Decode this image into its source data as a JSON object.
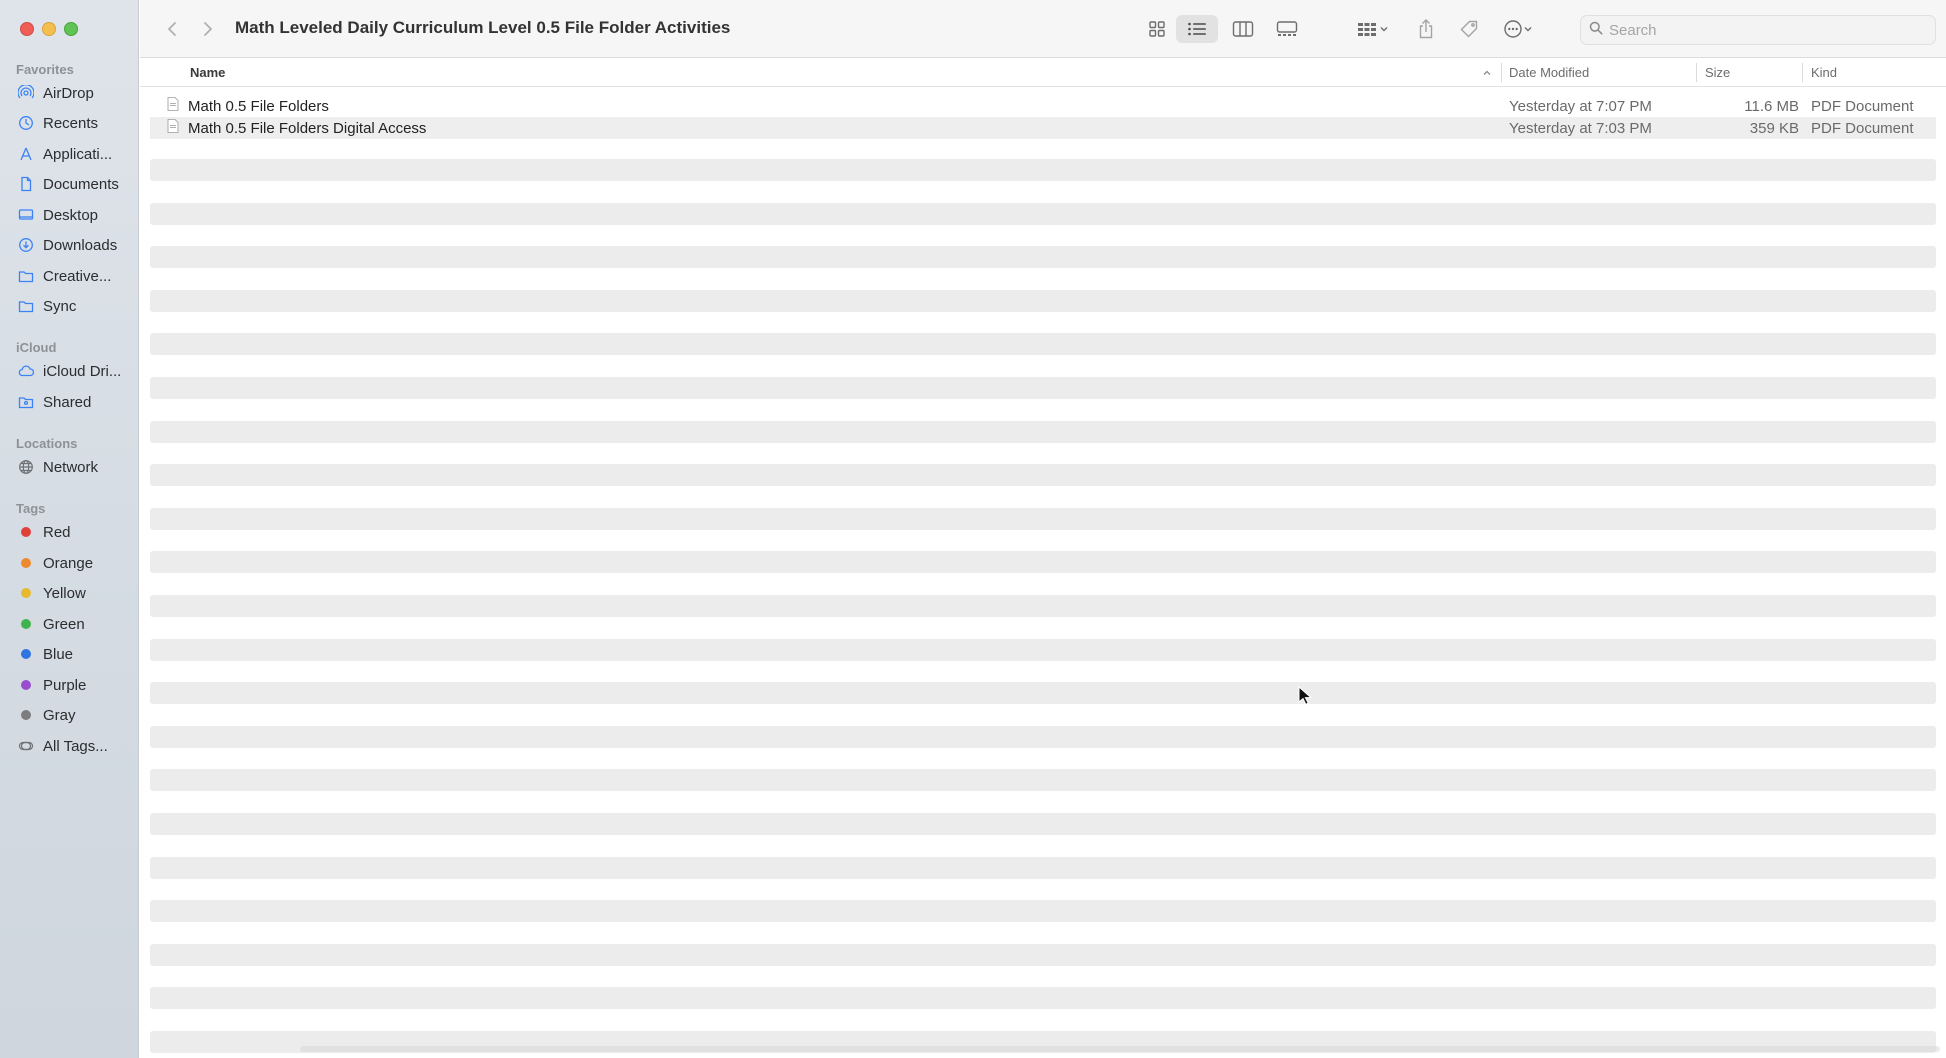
{
  "window": {
    "title": "Math Leveled Daily Curriculum Level 0.5 File Folder Activities"
  },
  "sidebar": {
    "favorites_header": "Favorites",
    "favorites": [
      {
        "label": "AirDrop",
        "icon": "airdrop-icon"
      },
      {
        "label": "Recents",
        "icon": "clock-icon"
      },
      {
        "label": "Applicati...",
        "icon": "applications-icon"
      },
      {
        "label": "Documents",
        "icon": "document-icon"
      },
      {
        "label": "Desktop",
        "icon": "desktop-icon"
      },
      {
        "label": "Downloads",
        "icon": "download-icon"
      },
      {
        "label": "Creative...",
        "icon": "folder-icon"
      },
      {
        "label": "Sync",
        "icon": "folder-icon"
      }
    ],
    "icloud_header": "iCloud",
    "icloud": [
      {
        "label": "iCloud Dri...",
        "icon": "cloud-icon"
      },
      {
        "label": "Shared",
        "icon": "shared-folder-icon"
      }
    ],
    "locations_header": "Locations",
    "locations": [
      {
        "label": "Network",
        "icon": "globe-icon"
      }
    ],
    "tags_header": "Tags",
    "tags": [
      {
        "label": "Red",
        "color": "#e0403a"
      },
      {
        "label": "Orange",
        "color": "#ec8a2f"
      },
      {
        "label": "Yellow",
        "color": "#e6b92e"
      },
      {
        "label": "Green",
        "color": "#3fb34d"
      },
      {
        "label": "Blue",
        "color": "#2f74e0"
      },
      {
        "label": "Purple",
        "color": "#9a4ccf"
      },
      {
        "label": "Gray",
        "color": "#7d7d80"
      }
    ],
    "all_tags": "All Tags..."
  },
  "toolbar": {
    "search_placeholder": "Search"
  },
  "columns": {
    "name": "Name",
    "date_modified": "Date Modified",
    "size": "Size",
    "kind": "Kind"
  },
  "files": [
    {
      "name": "Math 0.5 File Folders",
      "date": "Yesterday at 7:07 PM",
      "size": "11.6 MB",
      "kind": "PDF Document"
    },
    {
      "name": "Math 0.5 File Folders Digital Access",
      "date": "Yesterday at 7:03 PM",
      "size": "359 KB",
      "kind": "PDF Document"
    }
  ]
}
